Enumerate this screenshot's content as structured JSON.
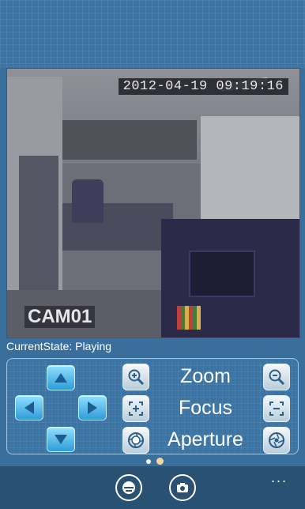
{
  "video": {
    "timestamp": "2012-04-19 09:19:16",
    "camera_label": "CAM01"
  },
  "status": {
    "text": "CurrentState: Playing"
  },
  "ptz": {
    "up_icon": "arrow-up-icon",
    "down_icon": "arrow-down-icon",
    "left_icon": "arrow-left-icon",
    "right_icon": "arrow-right-icon"
  },
  "controls": {
    "zoom_label": "Zoom",
    "focus_label": "Focus",
    "aperture_label": "Aperture"
  },
  "pager": {
    "page_count": 2,
    "active_page": 2,
    "active_color": "#f3d9a0",
    "inactive_color": "#ffffff"
  },
  "app_bar": {
    "buttons": [
      "ptz-toggle-icon",
      "camera-snapshot-icon"
    ],
    "more": "..."
  },
  "colors": {
    "background": "#3c74a4",
    "app_bar": "#285173",
    "border": "#9dc3e4"
  }
}
